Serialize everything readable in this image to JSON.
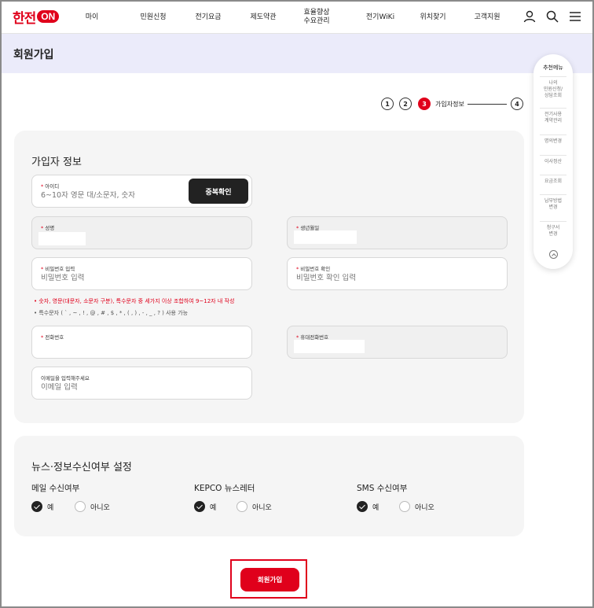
{
  "header": {
    "logo_text": "한전",
    "logo_on": "ON",
    "nav": [
      {
        "label": "마이"
      },
      {
        "label": "민원신청"
      },
      {
        "label": "전기요금"
      },
      {
        "label": "제도약관"
      },
      {
        "label": "효율향상\n수요관리"
      },
      {
        "label": "전기WiKi"
      },
      {
        "label": "위치찾기"
      },
      {
        "label": "고객지원"
      }
    ],
    "icons": [
      "user-icon",
      "search-icon",
      "menu-icon"
    ]
  },
  "page": {
    "title": "회원가입"
  },
  "steps": {
    "items": [
      "1",
      "2",
      "3",
      "4"
    ],
    "active_label": "가입자정보"
  },
  "member_info": {
    "title": "가입자 정보",
    "id_field": {
      "label": "아이디",
      "placeholder": "6~10자 영문 대/소문자, 숫자"
    },
    "dup_check_label": "중복확인",
    "name_field": {
      "label": "성명"
    },
    "birth_field": {
      "label": "생년월일"
    },
    "password_field": {
      "label": "비밀번호 입력",
      "placeholder": "비밀번호 입력"
    },
    "password_confirm_field": {
      "label": "비밀번호 확인",
      "placeholder": "비밀번호 확인 입력"
    },
    "hint_rule": "• 숫자, 영문(대문자, 소문자 구분), 특수문자 중 세가지 이상 조합하여 9~12자 내 작성",
    "hint_special": "• 특수문자 ( ` , ~ , ! , @ , # , $ , * , ( , ) , - , _ , ? ) 사용 가능",
    "phone_field": {
      "label": "전화번호"
    },
    "mobile_field": {
      "label": "휴대전화번호"
    },
    "email_field": {
      "label": "이메일을 입력해주세요",
      "placeholder": "이메일 입력"
    }
  },
  "subscription": {
    "title": "뉴스·정보수신여부 설정",
    "groups": [
      {
        "label": "메일 수신여부",
        "yes": "예",
        "no": "아니오",
        "selected": "yes"
      },
      {
        "label": "KEPCO 뉴스레터",
        "yes": "예",
        "no": "아니오",
        "selected": "yes"
      },
      {
        "label": "SMS 수신여부",
        "yes": "예",
        "no": "아니오",
        "selected": "yes"
      }
    ]
  },
  "submit_label": "회원가입",
  "quick_menu": {
    "title": "추천메뉴",
    "items": [
      "나의\n민원신청/\n상담조회",
      "전기사용\n계약관리",
      "명의변경",
      "이사정산",
      "요금조회",
      "납부방법\n변경",
      "청구서\n변경"
    ]
  },
  "colors": {
    "accent": "#e0001b",
    "title_band": "#ebebfa",
    "card_bg": "#f5f5f5"
  }
}
